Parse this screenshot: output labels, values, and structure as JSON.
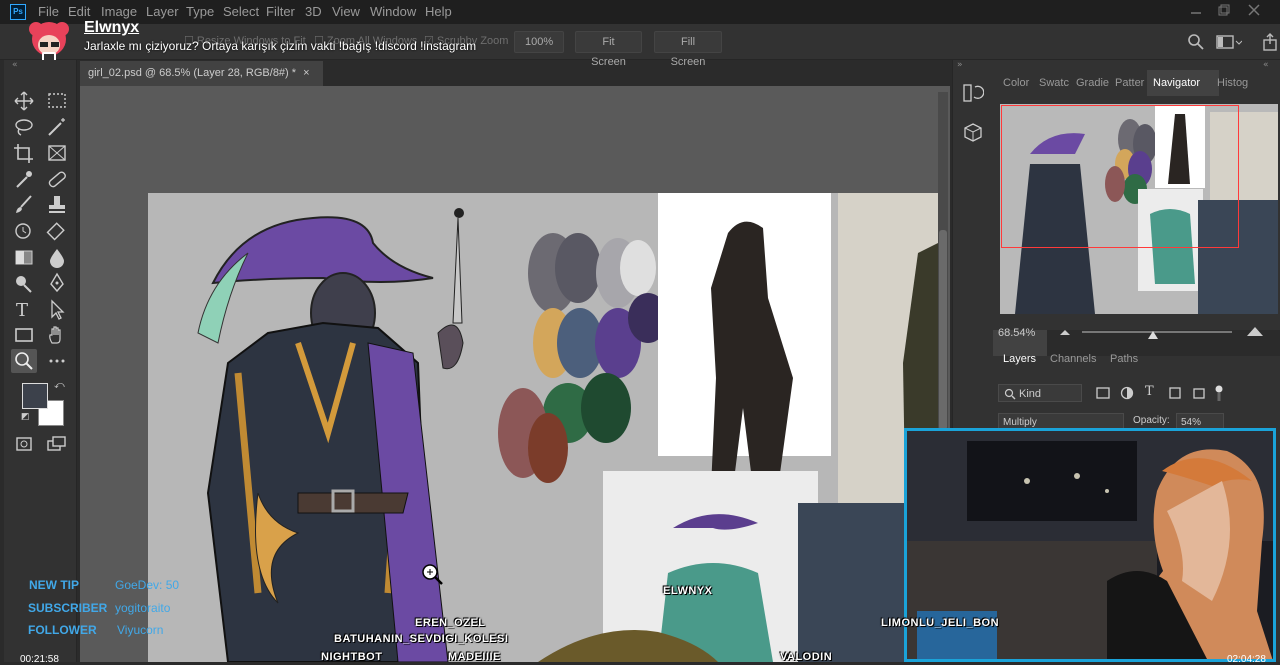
{
  "app": {
    "logo": "Ps"
  },
  "menu": [
    "File",
    "Edit",
    "Image",
    "Layer",
    "Type",
    "Select",
    "Filter",
    "3D",
    "View",
    "Window",
    "Help"
  ],
  "options": {
    "resize_label": "Resize Windows to Fit",
    "zoom_all_label": "Zoom All Windows",
    "scrubby_label": "Scrubby Zoom",
    "zoom_value": "100%",
    "fit_screen": "Fit Screen",
    "fill_screen": "Fill Screen"
  },
  "stream": {
    "streamer": "Elwnyx",
    "title": "Jarlaxle mı çiziyoruz? Ortaya karışık çizim vakti !bağış !discord !instagram"
  },
  "document": {
    "tab_title": "girl_02.psd @ 68.5% (Layer 28, RGB/8#) *",
    "close_glyph": "×"
  },
  "panels": {
    "top_tabs": [
      "Color",
      "Swatc",
      "Gradie",
      "Patter",
      "Navigator",
      "Histog"
    ],
    "active_top_tab": "Navigator",
    "navigator_zoom": "68.54%",
    "layer_tabs": [
      "Layers",
      "Channels",
      "Paths"
    ],
    "active_layer_tab": "Layers",
    "kind_label": "Kind",
    "blend_mode": "Multiply",
    "opacity_label": "Opacity:",
    "opacity_value": "54%"
  },
  "alerts": [
    {
      "label": "NEW TIP",
      "value": "GoeDev: 50"
    },
    {
      "label": "SUBSCRIBER",
      "value": "yogitoraito"
    },
    {
      "label": "FOLLOWER",
      "value": "Viyucorn"
    }
  ],
  "timers": {
    "left": "00:21:58",
    "right": "02:04:28"
  },
  "chat_names": [
    "ELWNYX",
    "EREN_OZEL",
    "BATUHANIN_SEVDIGI_KOLESI",
    "NIGHTBOT",
    "MADEIIIE",
    "LIMONLU_JELI_BON",
    "VALODIN"
  ],
  "colors": {
    "accent_blue": "#41a8e8",
    "webcam_border": "#1aa3d9",
    "navigator_box": "#ff3a3a"
  }
}
